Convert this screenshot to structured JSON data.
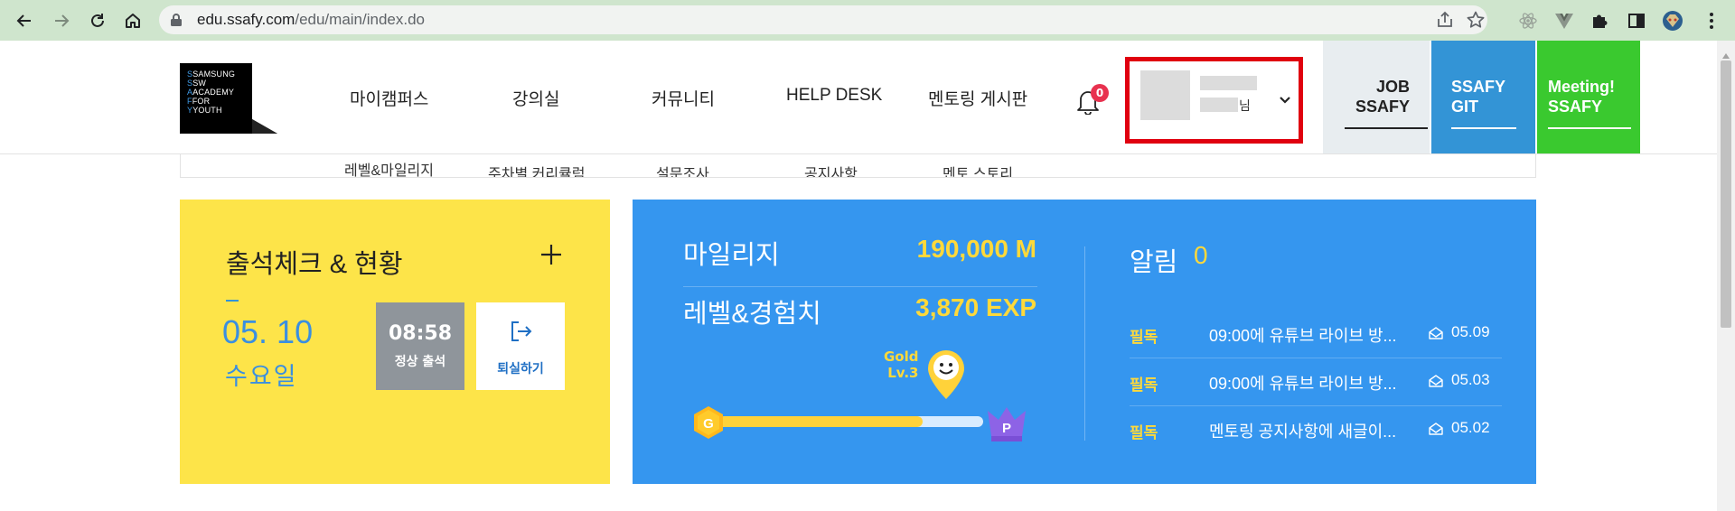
{
  "browser": {
    "url_host": "edu.ssafy.com",
    "url_path": "/edu/main/index.do"
  },
  "logo": {
    "lines": [
      "SAMSUNG",
      "SW",
      "ACADEMY",
      "FOR",
      "YOUTH"
    ]
  },
  "nav": {
    "items": [
      "마이캠퍼스",
      "강의실",
      "커뮤니티",
      "HELP DESK",
      "멘토링 게시판"
    ],
    "notification_count": "0"
  },
  "profile": {
    "suffix": "님"
  },
  "side_buttons": {
    "job": [
      "JOB",
      "SSAFY"
    ],
    "git": [
      "SSAFY",
      "GIT"
    ],
    "meeting": [
      "Meeting!",
      "SSAFY"
    ]
  },
  "submenu": {
    "items": [
      "레벨&마일리지",
      "주차별 커리큘럼",
      "설문조사",
      "공지사항",
      "멘토 스토리"
    ]
  },
  "attendance": {
    "title": "출석체크 & 현황",
    "date": "05. 10",
    "weekday": "수요일",
    "time": "08:58",
    "status": "정상 출석",
    "checkout_label": "퇴실하기"
  },
  "mileage": {
    "mileage_label": "마일리지",
    "mileage_value": "190,000 M",
    "level_label": "레벨&경험치",
    "level_value": "3,870 EXP",
    "tier_name": "Gold",
    "tier_level": "Lv.3",
    "progress": 0.77,
    "start_badge": "G",
    "end_badge": "P"
  },
  "alerts": {
    "label": "알림",
    "count": "0",
    "notices": [
      {
        "tag": "필독",
        "title": "09:00에 유튜브 라이브 방...",
        "date": "05.09"
      },
      {
        "tag": "필독",
        "title": "09:00에 유튜브 라이브 방...",
        "date": "05.03"
      },
      {
        "tag": "필독",
        "title": "멘토링 공지사항에 새글이...",
        "date": "05.02"
      }
    ]
  },
  "colors": {
    "attendance_bg": "#fde449",
    "panel_bg": "#3596ef",
    "accent_yellow": "#ffd93a",
    "git_bg": "#3394d6",
    "meeting_bg": "#3ac92f",
    "highlight_border": "#e0000f"
  }
}
